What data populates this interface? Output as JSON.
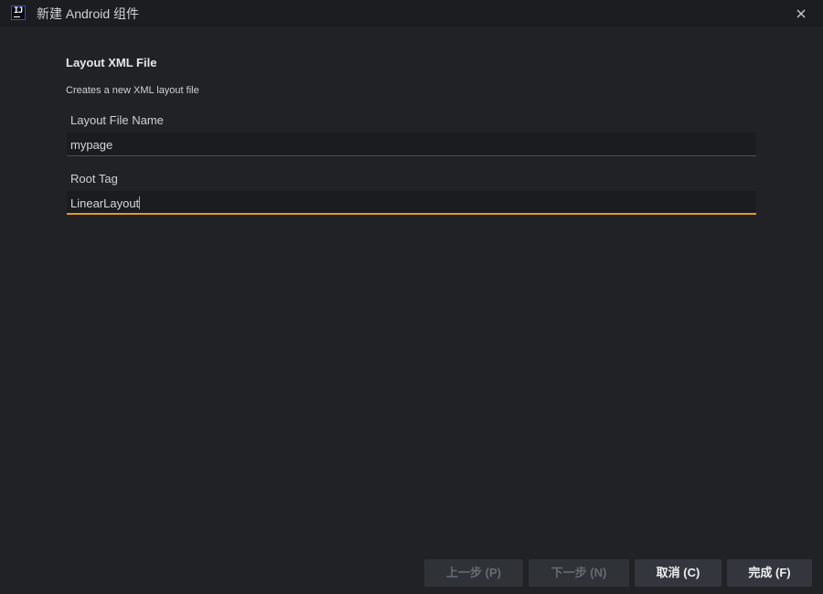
{
  "window": {
    "title": "新建 Android 组件",
    "app_icon_text": "IJ"
  },
  "header": {
    "heading": "Layout XML File",
    "subtitle": "Creates a new XML layout file"
  },
  "form": {
    "layout_file_name": {
      "label": "Layout File Name",
      "value": "mypage"
    },
    "root_tag": {
      "label": "Root Tag",
      "value": "LinearLayout"
    }
  },
  "footer": {
    "previous_label": "上一步 (P)",
    "next_label": "下一步 (N)",
    "cancel_label": "取消 (C)",
    "finish_label": "完成 (F)"
  },
  "colors": {
    "background": "#202226",
    "titlebar": "#1b1d21",
    "focus_accent": "#e59b1f",
    "button_active": "#33373d",
    "button_disabled": "#2f3338"
  }
}
